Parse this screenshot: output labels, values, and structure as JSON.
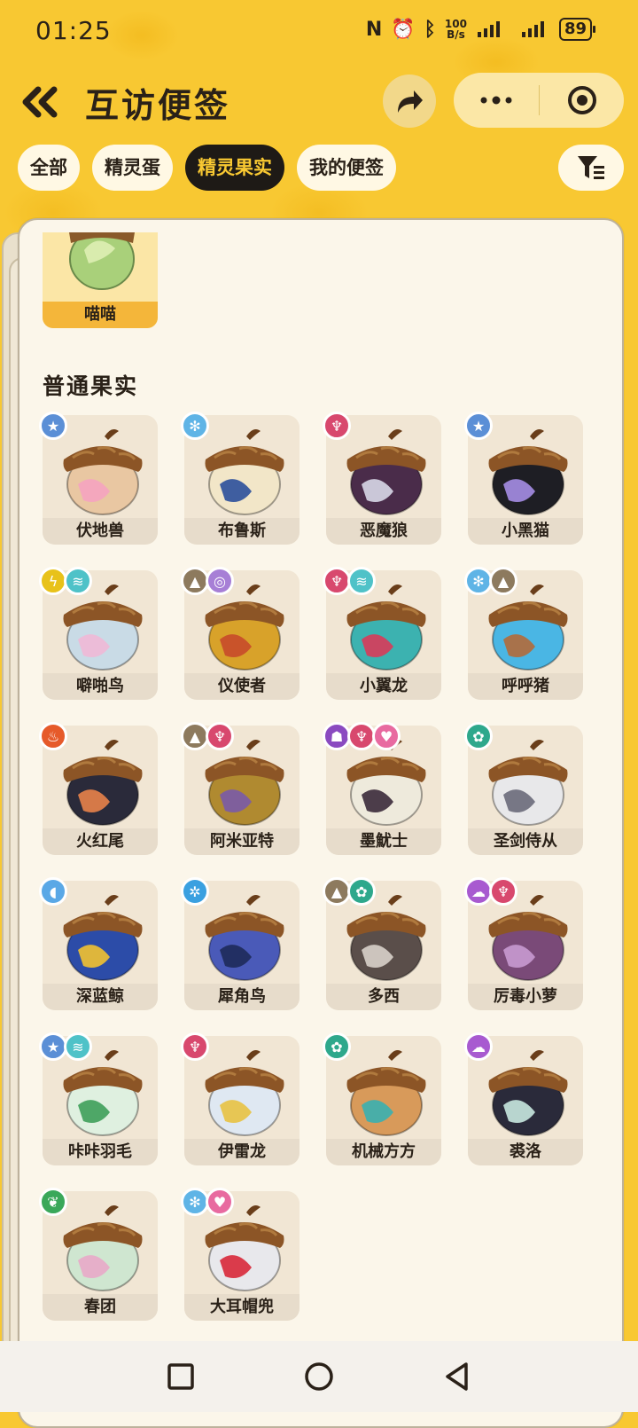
{
  "status": {
    "time": "01:25",
    "net_speed_top": "100",
    "net_speed_bottom": "B/s",
    "battery": "89"
  },
  "header": {
    "title": "互访便签",
    "back_icon": "double-chevron-left-icon",
    "share_icon": "share-arrow-icon",
    "more_icon": "more-dots-icon",
    "close_icon": "target-close-icon"
  },
  "tabs": [
    {
      "label": "全部",
      "active": false
    },
    {
      "label": "精灵蛋",
      "active": false
    },
    {
      "label": "精灵果实",
      "active": true
    },
    {
      "label": "我的便签",
      "active": false
    }
  ],
  "filter_icon": "filter-funnel-icon",
  "featured": {
    "label": "喵喵",
    "color": "#9fcf6b"
  },
  "section_title": "普通果实",
  "items": [
    {
      "label": "伏地兽",
      "shell": "#e9c7a2",
      "accent": "#f5a3c0",
      "badges": [
        {
          "icon": "star-icon",
          "color": "#5b8fd6"
        }
      ]
    },
    {
      "label": "布鲁斯",
      "shell": "#f2e6c8",
      "accent": "#2b4f9b",
      "badges": [
        {
          "icon": "snowflake-icon",
          "color": "#5fb4e6"
        }
      ]
    },
    {
      "label": "恶魔狼",
      "shell": "#4a2c4a",
      "accent": "#d8d8e8",
      "badges": [
        {
          "icon": "demon-icon",
          "color": "#d8486e"
        }
      ]
    },
    {
      "label": "小黑猫",
      "shell": "#1e1e24",
      "accent": "#a58de6",
      "badges": [
        {
          "icon": "star-icon",
          "color": "#5b8fd6"
        }
      ]
    },
    {
      "label": "噼啪鸟",
      "shell": "#c9dbe6",
      "accent": "#f0b8d6",
      "badges": [
        {
          "icon": "lightning-icon",
          "color": "#e8c21a"
        },
        {
          "icon": "wing-icon",
          "color": "#4fc2c8"
        }
      ]
    },
    {
      "label": "仪使者",
      "shell": "#d8a22a",
      "accent": "#c84a2a",
      "badges": [
        {
          "icon": "mountain-icon",
          "color": "#8d7a5e"
        },
        {
          "icon": "spiral-icon",
          "color": "#a77fd6"
        }
      ]
    },
    {
      "label": "小翼龙",
      "shell": "#3cb2b0",
      "accent": "#d83a5a",
      "badges": [
        {
          "icon": "demon-icon",
          "color": "#d8486e"
        },
        {
          "icon": "wing-icon",
          "color": "#4fc2c8"
        }
      ]
    },
    {
      "label": "呼呼猪",
      "shell": "#4ab6e4",
      "accent": "#b26a3a",
      "badges": [
        {
          "icon": "snowflake-icon",
          "color": "#5fb4e6"
        },
        {
          "icon": "mountain-icon",
          "color": "#8d7a5e"
        }
      ]
    },
    {
      "label": "火红尾",
      "shell": "#2a2a3a",
      "accent": "#e8824a",
      "badges": [
        {
          "icon": "fire-icon",
          "color": "#e65a2a"
        }
      ]
    },
    {
      "label": "阿米亚特",
      "shell": "#b08a30",
      "accent": "#7a5aa8",
      "badges": [
        {
          "icon": "mountain-icon",
          "color": "#8d7a5e"
        },
        {
          "icon": "demon-icon",
          "color": "#d8486e"
        }
      ]
    },
    {
      "label": "墨魷士",
      "shell": "#eeeadc",
      "accent": "#3a2a3a",
      "badges": [
        {
          "icon": "ghost-icon",
          "color": "#8a4ac0"
        },
        {
          "icon": "demon-icon",
          "color": "#d8486e"
        },
        {
          "icon": "heart-icon",
          "color": "#e86aa0"
        }
      ]
    },
    {
      "label": "圣剑侍从",
      "shell": "#e8e8ea",
      "accent": "#6a6a7a",
      "badges": [
        {
          "icon": "gear-icon",
          "color": "#2ea88c"
        }
      ]
    },
    {
      "label": "深蓝鲸",
      "shell": "#2c4ca8",
      "accent": "#f2c230",
      "badges": [
        {
          "icon": "water-drop-icon",
          "color": "#5aa8e6"
        }
      ]
    },
    {
      "label": "犀角鸟",
      "shell": "#4a5ab8",
      "accent": "#1e2a5a",
      "badges": [
        {
          "icon": "snowflake-gear-icon",
          "color": "#3aa0e0"
        }
      ]
    },
    {
      "label": "多西",
      "shell": "#5a4e4a",
      "accent": "#d8d2ca",
      "badges": [
        {
          "icon": "mountain-icon",
          "color": "#8d7a5e"
        },
        {
          "icon": "gear-icon",
          "color": "#2ea88c"
        }
      ]
    },
    {
      "label": "厉毒小萝",
      "shell": "#7a4a78",
      "accent": "#c89ad0",
      "badges": [
        {
          "icon": "poison-icon",
          "color": "#a85ad0"
        },
        {
          "icon": "demon-icon",
          "color": "#d8486e"
        }
      ]
    },
    {
      "label": "咔咔羽毛",
      "shell": "#dff0e0",
      "accent": "#3e9e5a",
      "badges": [
        {
          "icon": "star-icon",
          "color": "#5b8fd6"
        },
        {
          "icon": "wing-icon",
          "color": "#4fc2c8"
        }
      ]
    },
    {
      "label": "伊雷龙",
      "shell": "#dfe8f2",
      "accent": "#e8c242",
      "badges": [
        {
          "icon": "demon-icon",
          "color": "#d8486e"
        }
      ]
    },
    {
      "label": "机械方方",
      "shell": "#d89a5a",
      "accent": "#3ab0b0",
      "badges": [
        {
          "icon": "gear-icon",
          "color": "#2ea88c"
        }
      ]
    },
    {
      "label": "裘洛",
      "shell": "#2a2a3a",
      "accent": "#c8e8e0",
      "badges": [
        {
          "icon": "poison-icon",
          "color": "#a85ad0"
        }
      ]
    },
    {
      "label": "春团",
      "shell": "#cfe6d0",
      "accent": "#e8a8c8",
      "badges": [
        {
          "icon": "leaf-icon",
          "color": "#3aa85a"
        }
      ]
    },
    {
      "label": "大耳帽兜",
      "shell": "#e8e8ec",
      "accent": "#d8283a",
      "badges": [
        {
          "icon": "snowflake-icon",
          "color": "#5fb4e6"
        },
        {
          "icon": "heart-icon",
          "color": "#e86aa0"
        }
      ]
    }
  ],
  "nav": {
    "recent_icon": "square-recent-apps-icon",
    "home_icon": "circle-home-icon",
    "back_icon": "triangle-back-icon"
  }
}
